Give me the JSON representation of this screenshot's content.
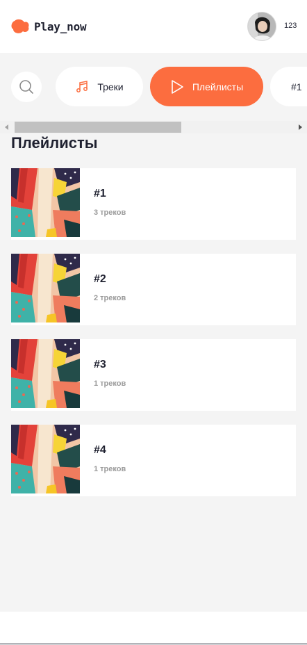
{
  "app": {
    "logo_text": "Play_now",
    "brand_color": "#fc6d3f"
  },
  "user": {
    "name": "123",
    "avatar_icon": "user-photo"
  },
  "tabs": [
    {
      "label": "Треки",
      "icon": "music-note-icon",
      "active": false
    },
    {
      "label": "Плейлисты",
      "icon": "play-icon",
      "active": true
    },
    {
      "label": "#1",
      "icon": "",
      "active": false
    }
  ],
  "search": {
    "icon": "search-icon"
  },
  "section": {
    "title": "Плейлисты"
  },
  "playlists": [
    {
      "title": "#1",
      "count": "3 треков"
    },
    {
      "title": "#2",
      "count": "2 треков"
    },
    {
      "title": "#3",
      "count": "1 треков"
    },
    {
      "title": "#4",
      "count": "1 треков"
    }
  ]
}
